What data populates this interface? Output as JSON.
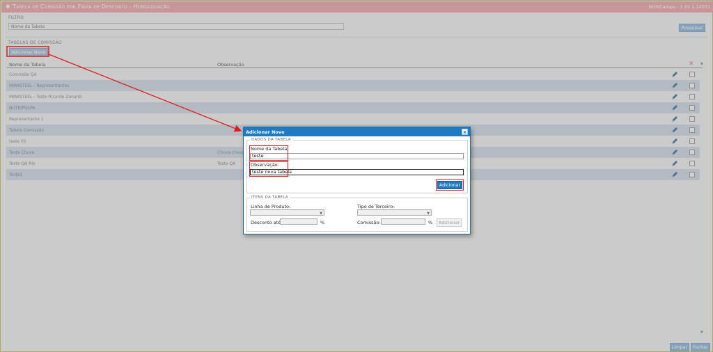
{
  "window": {
    "title": "Tabela de Comissão por Faixa de Desconto  - Homologação",
    "version": "RHISCampo - 2.25.1.14071"
  },
  "filter": {
    "section": "Filtro",
    "name_placeholder": "Nome da Tabela",
    "search_label": "Pesquisar"
  },
  "grid": {
    "section": "Tabelas de Comissão",
    "add_label": "Adicionar Novo",
    "col_name": "Nome da Tabela",
    "col_obs": "Observação",
    "delete_icon": "✕",
    "scroll_up": "▲",
    "scroll_down": "▼",
    "rows": [
      {
        "name": "Comissão QA",
        "obs": ""
      },
      {
        "name": "MIRASTEEL - Representantes",
        "obs": ""
      },
      {
        "name": "MIRASTEEL - Teste Ricardo Zanardi",
        "obs": ""
      },
      {
        "name": "NUTRIPOLPA",
        "obs": ""
      },
      {
        "name": "Representante 1",
        "obs": ""
      },
      {
        "name": "Tabela Comissão",
        "obs": ""
      },
      {
        "name": "teste 01",
        "obs": ""
      },
      {
        "name": "Teste Chuva",
        "obs": "Chuva chuva"
      },
      {
        "name": "Teste QA Rio",
        "obs": "Teste QA"
      },
      {
        "name": "Teste1",
        "obs": ""
      }
    ]
  },
  "footer": {
    "clear_label": "Limpar",
    "close_label": "Fechar"
  },
  "dialog": {
    "title": "Adicionar Novo",
    "close_icon": "x",
    "dados_legend": "Dados da Tabela",
    "nome_label": "Nome da Tabela:",
    "nome_value": "teste",
    "obs_label": "Observação:",
    "obs_value": "teste nova tabela",
    "add_label": "Adicionar",
    "itens_legend": "Itens da Tabela",
    "linha_label": "Linha de Produto:",
    "tipo_label": "Tipo de Terceiro:",
    "desconto_label": "Desconto até:",
    "comissao_label": "Comissão:",
    "pct": "%",
    "itens_add_label": "Adicionar"
  },
  "colors": {
    "accent": "#1e7bc2",
    "titlebar": "#e9a5a8",
    "highlight": "#e01b1b"
  }
}
